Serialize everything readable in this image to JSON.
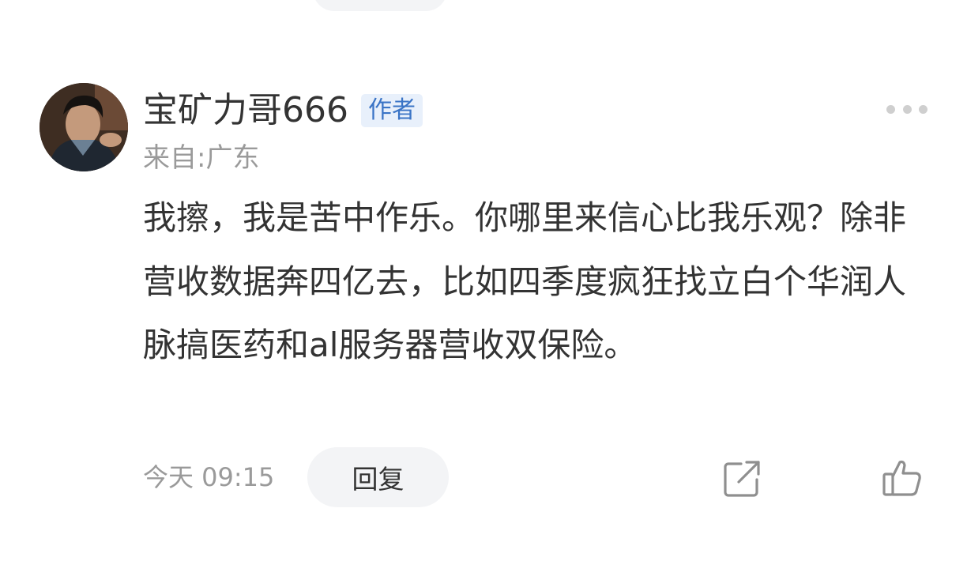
{
  "comment": {
    "username": "宝矿力哥666",
    "badge": "作者",
    "location": "来自:广东",
    "text": "我擦，我是苦中作乐。你哪里来信心比我乐观？除非营收数据奔四亿去，比如四季度疯狂找立白个华润人脉搞医药和al服务器营收双保险。",
    "time": "今天 09:15",
    "reply_label": "回复",
    "icons": {
      "more": "more-dots-icon",
      "share": "share-icon",
      "like": "thumbs-up-icon"
    }
  },
  "colors": {
    "text": "#333333",
    "secondary": "#9a9a9a",
    "badge_text": "#3a74c6",
    "badge_bg": "#e8f0fb",
    "pill_bg": "#f3f4f6",
    "icon": "#8f8f8f"
  }
}
